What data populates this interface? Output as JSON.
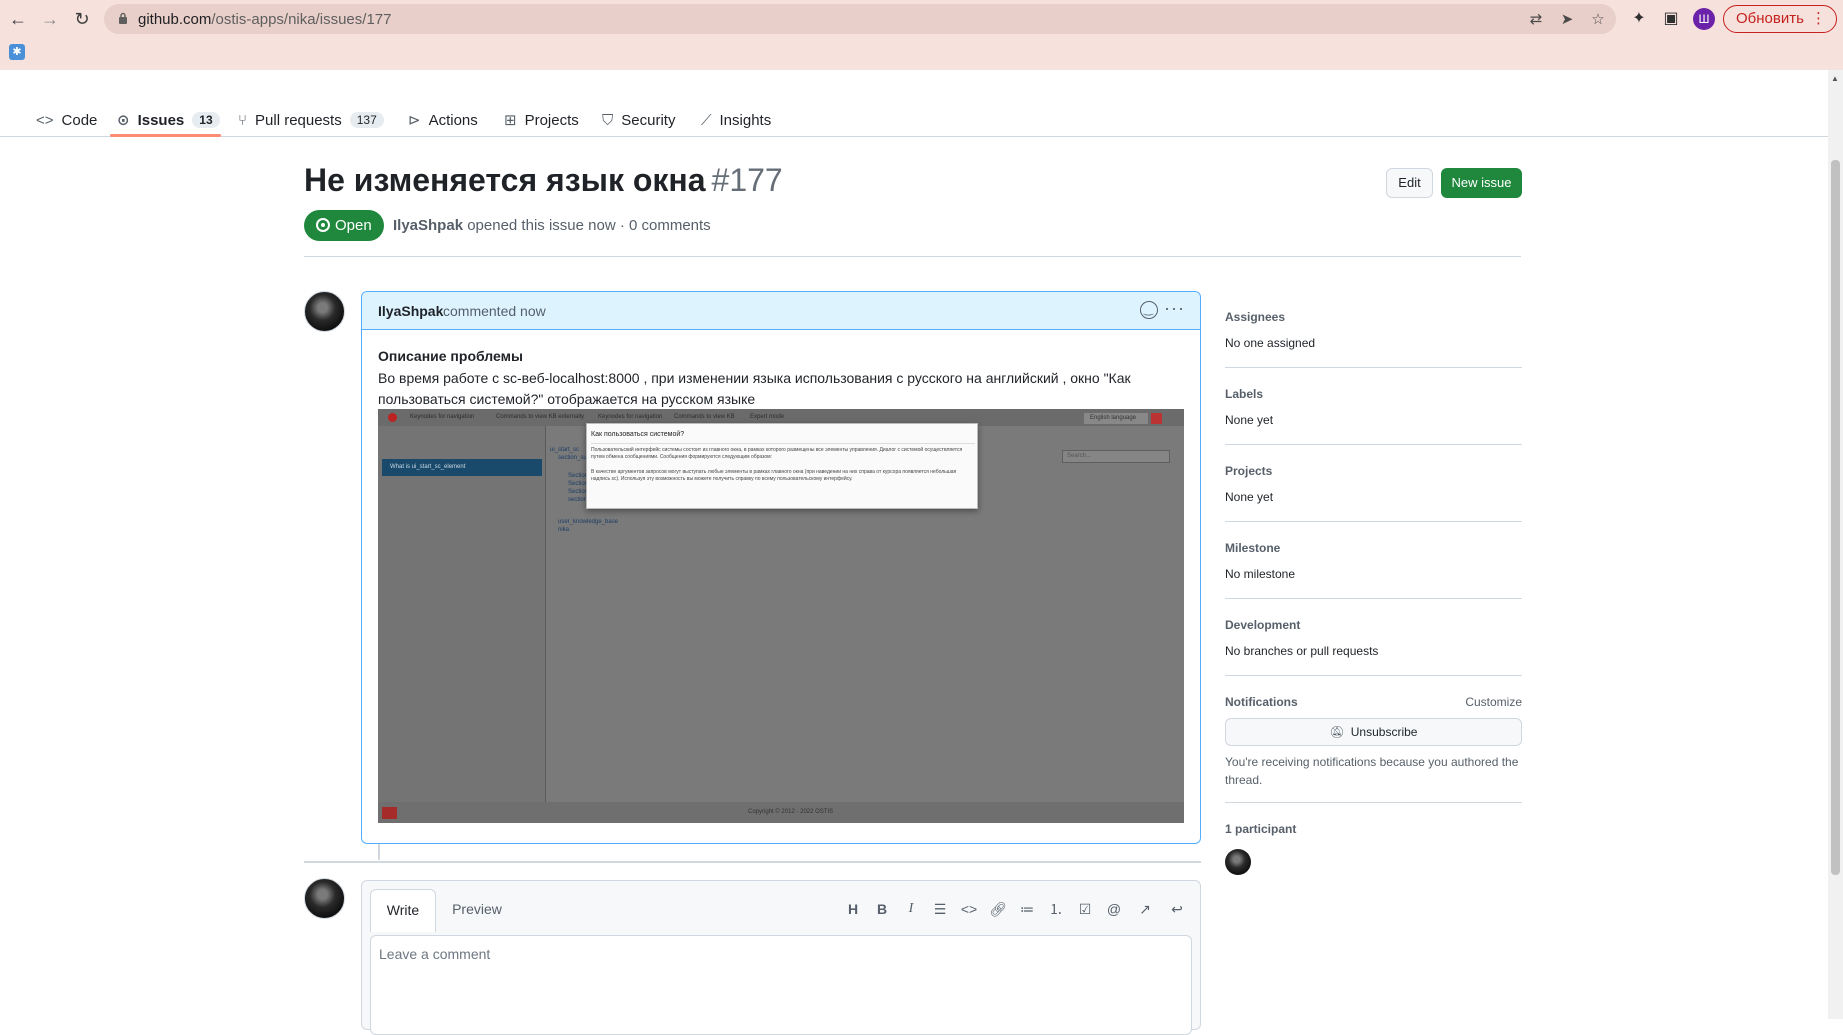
{
  "browser": {
    "url_host": "github.com",
    "url_path": "/ostis-apps/nika/issues/177",
    "profile_initial": "Ш",
    "update_label": "Обновить"
  },
  "repo_nav": {
    "tabs": [
      {
        "label": "Code",
        "icon": "code-icon"
      },
      {
        "label": "Issues",
        "icon": "issue-opened-icon",
        "count": "13",
        "active": true
      },
      {
        "label": "Pull requests",
        "icon": "git-pull-request-icon",
        "count": "137"
      },
      {
        "label": "Actions",
        "icon": "play-icon"
      },
      {
        "label": "Projects",
        "icon": "table-icon"
      },
      {
        "label": "Security",
        "icon": "shield-icon"
      },
      {
        "label": "Insights",
        "icon": "graph-icon"
      }
    ]
  },
  "issue": {
    "title": "Не изменяется язык окна",
    "number": "#177",
    "state": "Open",
    "author": "IlyaShpak",
    "meta_text": " opened this issue now · 0 comments",
    "edit_label": "Edit",
    "new_issue_label": "New issue"
  },
  "comment": {
    "author": "IlyaShpak",
    "when": "commented now",
    "heading": "Описание проблемы",
    "body": "Во время работе с sc-веб-localhost:8000 , при изменении языка использования с русского на английский , окно \"Как пользоваться системой?\" отображается на русском языке",
    "screenshot": {
      "toolbar_items": [
        "Keynodes for navigation",
        "Commands to view KB externally",
        "Keynodes for navigation",
        "Commands to view KB",
        "Expert mode"
      ],
      "language": "English language",
      "left_item": "What is ui_start_sc_element",
      "search_placeholder": "Search...",
      "tree_items": [
        "ui_start_sc",
        "section_su",
        "Section",
        "Section",
        "Section",
        "section",
        "user_knowledge_base",
        "nika"
      ],
      "footer": "Copyright © 2012 - 2022 OSTIS",
      "modal_title": "Как пользоваться системой?",
      "modal_p1": "Пользовательский интерфейс системы состоит из главного окна, в рамках которого размещены все элементы управления. Диалог с системой осуществляется путем обмена сообщениями. Сообщения формируются следующим образом:",
      "modal_p2": "В качестве аргументов запросов могут выступать любые элементы в рамках главного окна (при наведении на них справа от курсора появляется небольшая надпись sc). Используя эту возможность вы можете получить справку по всему пользовательскому интерфейсу."
    }
  },
  "composer": {
    "write_label": "Write",
    "preview_label": "Preview",
    "placeholder": "Leave a comment",
    "tools": [
      "heading-icon",
      "bold-icon",
      "italic-icon",
      "quote-icon",
      "code-icon",
      "link-icon",
      "unordered-list-icon",
      "ordered-list-icon",
      "tasklist-icon",
      "mention-icon",
      "cross-reference-icon",
      "reply-icon"
    ]
  },
  "sidebar": {
    "assignees_title": "Assignees",
    "assignees_value": "No one assigned",
    "labels_title": "Labels",
    "labels_value": "None yet",
    "projects_title": "Projects",
    "projects_value": "None yet",
    "milestone_title": "Milestone",
    "milestone_value": "No milestone",
    "development_title": "Development",
    "development_value": "No branches or pull requests",
    "notifications_title": "Notifications",
    "customize_label": "Customize",
    "unsubscribe_label": "Unsubscribe",
    "notifications_note": "You're receiving notifications because you authored the thread.",
    "participants_title": "1 participant"
  },
  "colors": {
    "accent_green": "#1f883d",
    "tab_underline": "#fd8c73",
    "comment_header_bg": "#ddf4ff",
    "comment_border": "#54aeff"
  }
}
